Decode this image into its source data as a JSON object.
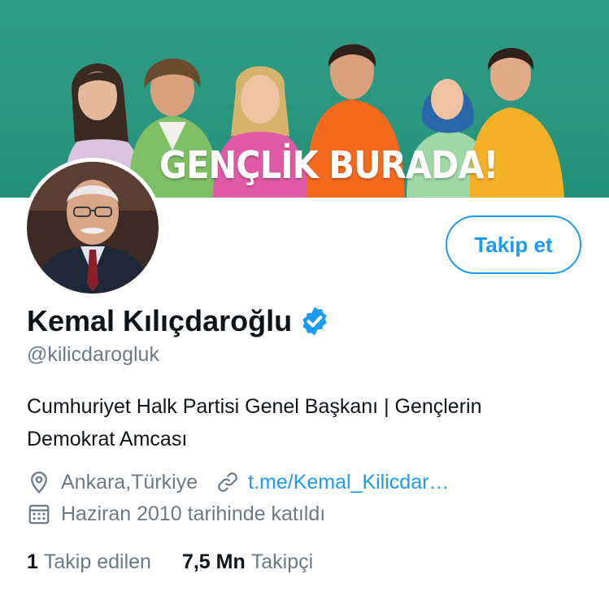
{
  "banner": {
    "slogan": "GENÇLİK BURADA!",
    "colors": {
      "background": "#2a967f",
      "hoodie_orange": "#f36a1e",
      "shirt_yellow": "#f4b127",
      "shirt_pink": "#e05aa6",
      "hijab_blue": "#2a66a8",
      "shirt_green": "#7fbf66",
      "shirt_lilac": "#d9c3df"
    }
  },
  "profile": {
    "follow_label": "Takip et",
    "display_name": "Kemal Kılıçdaroğlu",
    "verified_icon": "verified-badge-icon",
    "handle": "@kilicdarogluk",
    "bio": "Cumhuriyet Halk Partisi Genel Başkanı | Gençlerin Demokrat Amcası",
    "location": "Ankara,Türkiye",
    "location_icon": "location-pin-icon",
    "link": "t.me/Kemal_Kilicdar…",
    "link_icon": "link-icon",
    "joined": "Haziran 2010 tarihinde katıldı",
    "joined_icon": "calendar-icon"
  },
  "stats": {
    "following_count": "1",
    "following_label": "Takip edilen",
    "followers_count": "7,5 Mn",
    "followers_label": "Takipçi"
  },
  "colors": {
    "accent": "#1d9bf0",
    "secondary_text": "#6b7a86",
    "primary_text": "#0f1419"
  }
}
